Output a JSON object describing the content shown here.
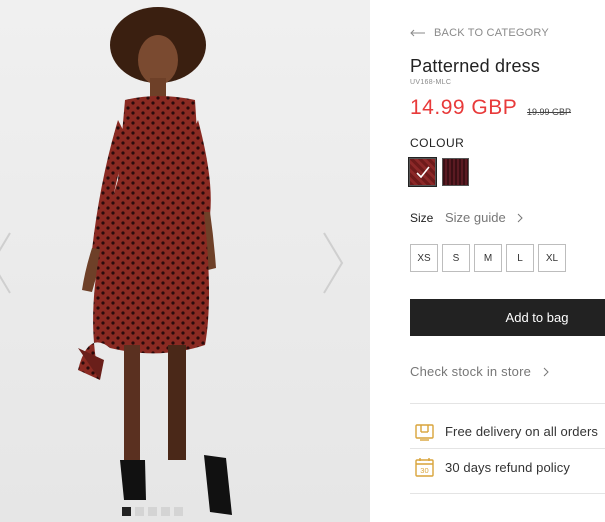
{
  "gallery": {
    "image_alt": "Model wearing patterned dress",
    "dots_count": 5,
    "active_dot": 1
  },
  "product": {
    "back_label": "BACK TO CATEGORY",
    "title": "Patterned dress",
    "sku": "UV168-MLC",
    "price": "14.99 GBP",
    "old_price": "19.99 GBP",
    "colour_label": "COLOUR",
    "colours": [
      "#7a1f1f",
      "#4a1219"
    ],
    "size_label": "Size",
    "size_guide_label": "Size guide",
    "sizes": [
      "XS",
      "S",
      "M",
      "L",
      "XL"
    ],
    "add_to_bag_label": "Add to bag",
    "check_stock_label": "Check stock in store",
    "features": [
      {
        "icon": "delivery-icon",
        "label": "Free delivery on all orders"
      },
      {
        "icon": "calendar-30-icon",
        "icon_text": "30",
        "label": "30 days refund policy"
      }
    ]
  },
  "colors": {
    "price_red": "#e83a3a",
    "button_dark": "#222222",
    "icon_gold": "#d9a43a"
  }
}
